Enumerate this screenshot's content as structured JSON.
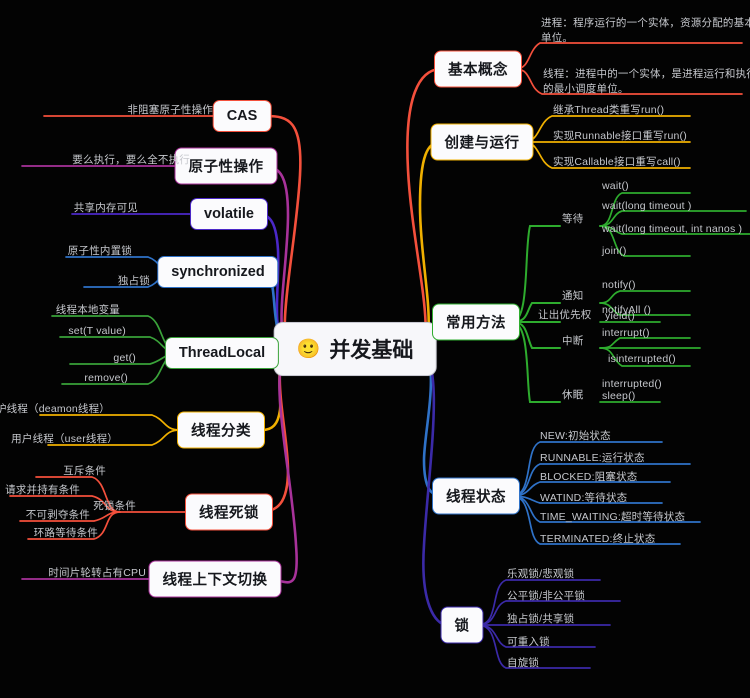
{
  "root": {
    "label": "并发基础",
    "emoji": "🙂",
    "icon": "smiley-face-icon"
  },
  "colors": {
    "basic_concept": "#f4503c",
    "create_run": "#f0b000",
    "common_methods": "#2eac2e",
    "thread_state": "#2f72c8",
    "lock": "#3b2aa8",
    "cas": "#f4503c",
    "atomic": "#a8329a",
    "volatile": "#4b28c8",
    "synchronized": "#2f72c8",
    "threadlocal": "#3aa33a",
    "thread_type": "#f0b000",
    "deadlock": "#f4503c",
    "context_switch": "#a8329a",
    "node_text": "#16181d",
    "leaf_text": "#c6c8cd",
    "background": "#030303"
  },
  "right_branches": [
    {
      "label": "基本概念",
      "children": [
        {
          "label": "进程：程序运行的一个实体，资源分配的基本单位。"
        },
        {
          "label": "线程：进程中的一个实体，是进程运行和执行的最小调度单位。"
        }
      ]
    },
    {
      "label": "创建与运行",
      "children": [
        {
          "label": "继承Thread类重写run()"
        },
        {
          "label": "实现Runnable接口重写run()"
        },
        {
          "label": "实现Callable接口重写call()"
        }
      ]
    },
    {
      "label": "常用方法",
      "groups": [
        {
          "label": "等待",
          "children": [
            {
              "label": "wait()"
            },
            {
              "label": "wait(long timeout )"
            },
            {
              "label": "wait(long timeout, int nanos )"
            },
            {
              "label": "join()"
            }
          ]
        },
        {
          "label": "通知",
          "children": [
            {
              "label": "notify()"
            },
            {
              "label": "notifyAll ()"
            }
          ]
        },
        {
          "label": "让出优先权",
          "children": [
            {
              "label": "yield()"
            }
          ]
        },
        {
          "label": "中断",
          "children": [
            {
              "label": "interrupt()"
            },
            {
              "label": "isinterrupted()"
            },
            {
              "label": "interrupted()"
            }
          ]
        },
        {
          "label": "休眠",
          "children": [
            {
              "label": "sleep()"
            }
          ]
        }
      ]
    },
    {
      "label": "线程状态",
      "children": [
        {
          "label": "NEW:初始状态"
        },
        {
          "label": "RUNNABLE:运行状态"
        },
        {
          "label": "BLOCKED:阻塞状态"
        },
        {
          "label": "WATIND:等待状态"
        },
        {
          "label": "TIME_WAITING:超时等待状态"
        },
        {
          "label": "TERMINATED:终止状态"
        }
      ]
    },
    {
      "label": "锁",
      "children": [
        {
          "label": "乐观锁/悲观锁"
        },
        {
          "label": "公平锁/非公平锁"
        },
        {
          "label": "独占锁/共享锁"
        },
        {
          "label": "可重入锁"
        },
        {
          "label": "自旋锁"
        }
      ]
    }
  ],
  "left_branches": [
    {
      "label": "CAS",
      "children": [
        {
          "label": "非阻塞原子性操作"
        }
      ]
    },
    {
      "label": "原子性操作",
      "children": [
        {
          "label": "要么执行，要么全不执行"
        }
      ]
    },
    {
      "label": "volatile",
      "children": [
        {
          "label": "共享内存可见"
        }
      ]
    },
    {
      "label": "synchronized",
      "children": [
        {
          "label": "原子性内置锁"
        },
        {
          "label": "独占锁"
        }
      ]
    },
    {
      "label": "ThreadLocal",
      "children": [
        {
          "label": "线程本地变量"
        },
        {
          "label": "set(T value)"
        },
        {
          "label": "get()"
        },
        {
          "label": "remove()"
        }
      ]
    },
    {
      "label": "线程分类",
      "children": [
        {
          "label": "守护线程（deamon线程）"
        },
        {
          "label": "用户线程（user线程）"
        }
      ]
    },
    {
      "label": "线程死锁",
      "group": "死锁条件",
      "children": [
        {
          "label": "互斥条件"
        },
        {
          "label": "请求并持有条件"
        },
        {
          "label": "不可剥夺条件"
        },
        {
          "label": "环路等待条件"
        }
      ]
    },
    {
      "label": "线程上下文切换",
      "children": [
        {
          "label": "时间片轮转占有CPU"
        }
      ]
    }
  ]
}
